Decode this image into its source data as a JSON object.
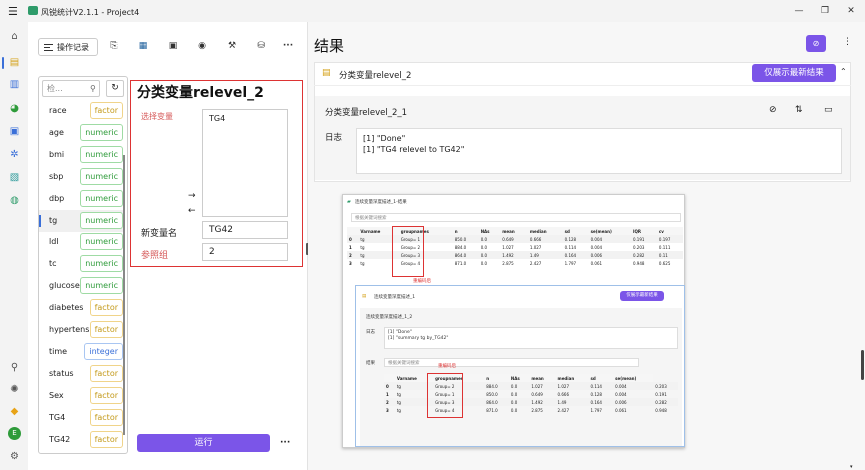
{
  "window": {
    "title": "风锐统计V2.1.1 - Project4"
  },
  "toolbar": {
    "history_label": "操作记录",
    "more": "···"
  },
  "variables": {
    "search_placeholder": "检...",
    "items": [
      {
        "name": "race",
        "type": "factor"
      },
      {
        "name": "age",
        "type": "numeric"
      },
      {
        "name": "bmi",
        "type": "numeric"
      },
      {
        "name": "sbp",
        "type": "numeric"
      },
      {
        "name": "dbp",
        "type": "numeric"
      },
      {
        "name": "tg",
        "type": "numeric"
      },
      {
        "name": "ldl",
        "type": "numeric"
      },
      {
        "name": "tc",
        "type": "numeric"
      },
      {
        "name": "glucose",
        "type": "numeric"
      },
      {
        "name": "diabetes",
        "type": "factor"
      },
      {
        "name": "hypertension",
        "type": "factor"
      },
      {
        "name": "time",
        "type": "integer"
      },
      {
        "name": "status",
        "type": "factor"
      },
      {
        "name": "Sex",
        "type": "factor"
      },
      {
        "name": "TG4",
        "type": "factor"
      },
      {
        "name": "TG42",
        "type": "factor"
      }
    ]
  },
  "dialog": {
    "title": "分类变量relevel_2",
    "select_label": "选择变量",
    "selected_var": "TG4",
    "arrow_right": "→",
    "arrow_left": "←",
    "new_var_label": "新变量名",
    "new_var_value": "TG42",
    "ref_label": "参照组",
    "ref_value": "2",
    "run_label": "运行",
    "more": "···"
  },
  "results": {
    "title": "结果",
    "card_title": "分类变量relevel_2",
    "show_latest": "仅展示最新结果",
    "sub_title": "分类变量relevel_2_1",
    "log_label": "日志",
    "log_lines": [
      "[1] \"Done\"",
      "[1] \"TG4 relevel to  TG42\""
    ]
  },
  "screenshot": {
    "title": "连续变量深度描述_1-结果",
    "search_placeholder": "根据关键词搜索",
    "headers": [
      "",
      "Varname",
      "groupnames",
      "n",
      "NAs",
      "mean",
      "median",
      "sd",
      "se(mean)",
      "IQR",
      "cv"
    ],
    "rows": [
      [
        "0",
        "tg",
        "Group= 1",
        "850.0",
        "0.0",
        "0.649",
        "0.666",
        "0.128",
        "0.004",
        "0.191",
        "0.197"
      ],
      [
        "1",
        "tg",
        "Group= 2",
        "884.0",
        "0.0",
        "1.027",
        "1.027",
        "0.114",
        "0.004",
        "0.203",
        "0.111"
      ],
      [
        "2",
        "tg",
        "Group= 3",
        "864.0",
        "0.0",
        "1.492",
        "1.49",
        "0.164",
        "0.006",
        "0.282",
        "0.11"
      ],
      [
        "3",
        "tg",
        "Group= 4",
        "871.0",
        "0.0",
        "2.875",
        "2.427",
        "1.797",
        "0.061",
        "0.948",
        "0.625"
      ]
    ],
    "annot": "重编码后",
    "inner_card_title": "连续变量深度描述_1",
    "inner_show_latest": "仅展示最新结果",
    "inner_sub_title": "连续变量深度描述_1_2",
    "inner_log_label": "日志",
    "inner_log_lines": [
      "[1] \"Done\"",
      "[1] \"summary tg by_TG42\""
    ],
    "inner_result_label": "结果",
    "inner_search": "根据关键词搜索",
    "headers2": [
      "",
      "Varname",
      "groupnames",
      "n",
      "NAs",
      "mean",
      "median",
      "sd",
      "se(mean)"
    ],
    "rows2": [
      [
        "0",
        "tg",
        "Group= 2",
        "884.0",
        "0.0",
        "1.027",
        "1.027",
        "0.114",
        "0.004",
        "0.203"
      ],
      [
        "1",
        "tg",
        "Group= 1",
        "850.0",
        "0.0",
        "0.649",
        "0.666",
        "0.128",
        "0.004",
        "0.191"
      ],
      [
        "2",
        "tg",
        "Group= 3",
        "864.0",
        "0.0",
        "1.492",
        "1.49",
        "0.164",
        "0.006",
        "0.282"
      ],
      [
        "3",
        "tg",
        "Group= 4",
        "871.0",
        "0.0",
        "2.875",
        "2.427",
        "1.797",
        "0.061",
        "0.948"
      ]
    ],
    "annot2": "重编码后"
  },
  "colors": {
    "accent": "#7b55e8",
    "highlight": "#dd3333"
  }
}
